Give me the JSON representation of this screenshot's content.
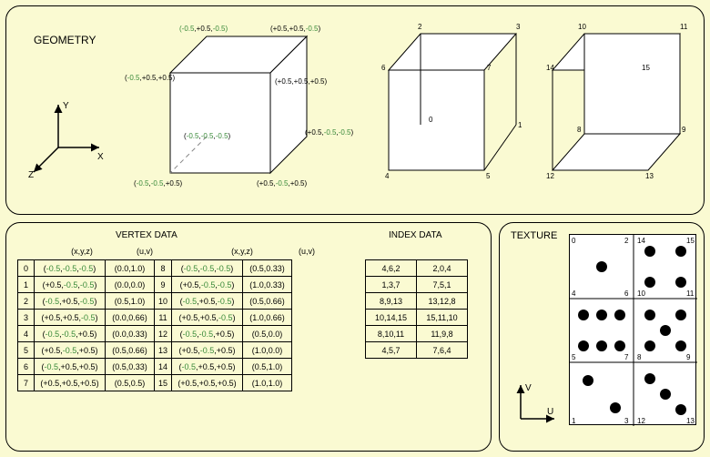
{
  "titles": {
    "geometry": "GEOMETRY",
    "vertex_data": "VERTEX DATA",
    "index_data": "INDEX DATA",
    "texture": "TEXTURE"
  },
  "col_headers": [
    "(x,y,z)",
    "(u,v)",
    "(x,y,z)",
    "(u,v)"
  ],
  "axis": {
    "x": "X",
    "y": "Y",
    "z": "Z",
    "u": "U",
    "v": "V"
  },
  "cube_vertices": {
    "back_tl": "(-0.5,+0.5,-0.5)",
    "back_tr": "(+0.5,+0.5,-0.5)",
    "front_tl": "(-0.5,+0.5,+0.5)",
    "front_tr": "(+0.5,+0.5,+0.5)",
    "back_bl": "(-0.5,-0.5,-0.5)",
    "back_br": "(+0.5,-0.5,-0.5)",
    "front_bl": "(-0.5,-0.5,+0.5)",
    "front_br": "(+0.5,-0.5,+0.5)"
  },
  "mid_labels": [
    "0",
    "1",
    "2",
    "3",
    "4",
    "5",
    "6",
    "7"
  ],
  "right_labels": [
    "8",
    "9",
    "10",
    "11",
    "12",
    "13",
    "14",
    "15"
  ],
  "vertex_rows": [
    {
      "i": "0",
      "xyz": "(-0.5,-0.5,-0.5)",
      "uv": "(0.0,1.0)"
    },
    {
      "i": "1",
      "xyz": "(+0.5,-0.5,-0.5)",
      "uv": "(0.0,0.0)"
    },
    {
      "i": "2",
      "xyz": "(-0.5,+0.5,-0.5)",
      "uv": "(0.5,1.0)"
    },
    {
      "i": "3",
      "xyz": "(+0.5,+0.5,-0.5)",
      "uv": "(0.0,0.66)"
    },
    {
      "i": "4",
      "xyz": "(-0.5,-0.5,+0.5)",
      "uv": "(0.0,0.33)"
    },
    {
      "i": "5",
      "xyz": "(+0.5,-0.5,+0.5)",
      "uv": "(0.5,0.66)"
    },
    {
      "i": "6",
      "xyz": "(-0.5,+0.5,+0.5)",
      "uv": "(0.5,0.33)"
    },
    {
      "i": "7",
      "xyz": "(+0.5,+0.5,+0.5)",
      "uv": "(0.5,0.5)"
    },
    {
      "i": "8",
      "xyz": "(-0.5,-0.5,-0.5)",
      "uv": "(0.5,0.33)"
    },
    {
      "i": "9",
      "xyz": "(+0.5,-0.5,-0.5)",
      "uv": "(1.0,0.33)"
    },
    {
      "i": "10",
      "xyz": "(-0.5,+0.5,-0.5)",
      "uv": "(0.5,0.66)"
    },
    {
      "i": "11",
      "xyz": "(+0.5,+0.5,-0.5)",
      "uv": "(1.0,0.66)"
    },
    {
      "i": "12",
      "xyz": "(-0.5,-0.5,+0.5)",
      "uv": "(0.5,0.0)"
    },
    {
      "i": "13",
      "xyz": "(+0.5,-0.5,+0.5)",
      "uv": "(1.0,0.0)"
    },
    {
      "i": "14",
      "xyz": "(-0.5,+0.5,+0.5)",
      "uv": "(0.5,1.0)"
    },
    {
      "i": "15",
      "xyz": "(+0.5,+0.5,+0.5)",
      "uv": "(1.0,1.0)"
    }
  ],
  "index_rows": [
    [
      "4,6,2",
      "2,0,4"
    ],
    [
      "1,3,7",
      "7,5,1"
    ],
    [
      "8,9,13",
      "13,12,8"
    ],
    [
      "10,14,15",
      "15,11,10"
    ],
    [
      "8,10,11",
      "11,9,8"
    ],
    [
      "4,5,7",
      "7,6,4"
    ]
  ],
  "dice": {
    "grid_labels": [
      "0",
      "2",
      "14",
      "15",
      "4",
      "6",
      "10",
      "11",
      "5",
      "7",
      "8",
      "9",
      "1",
      "3",
      "12",
      "13"
    ]
  }
}
